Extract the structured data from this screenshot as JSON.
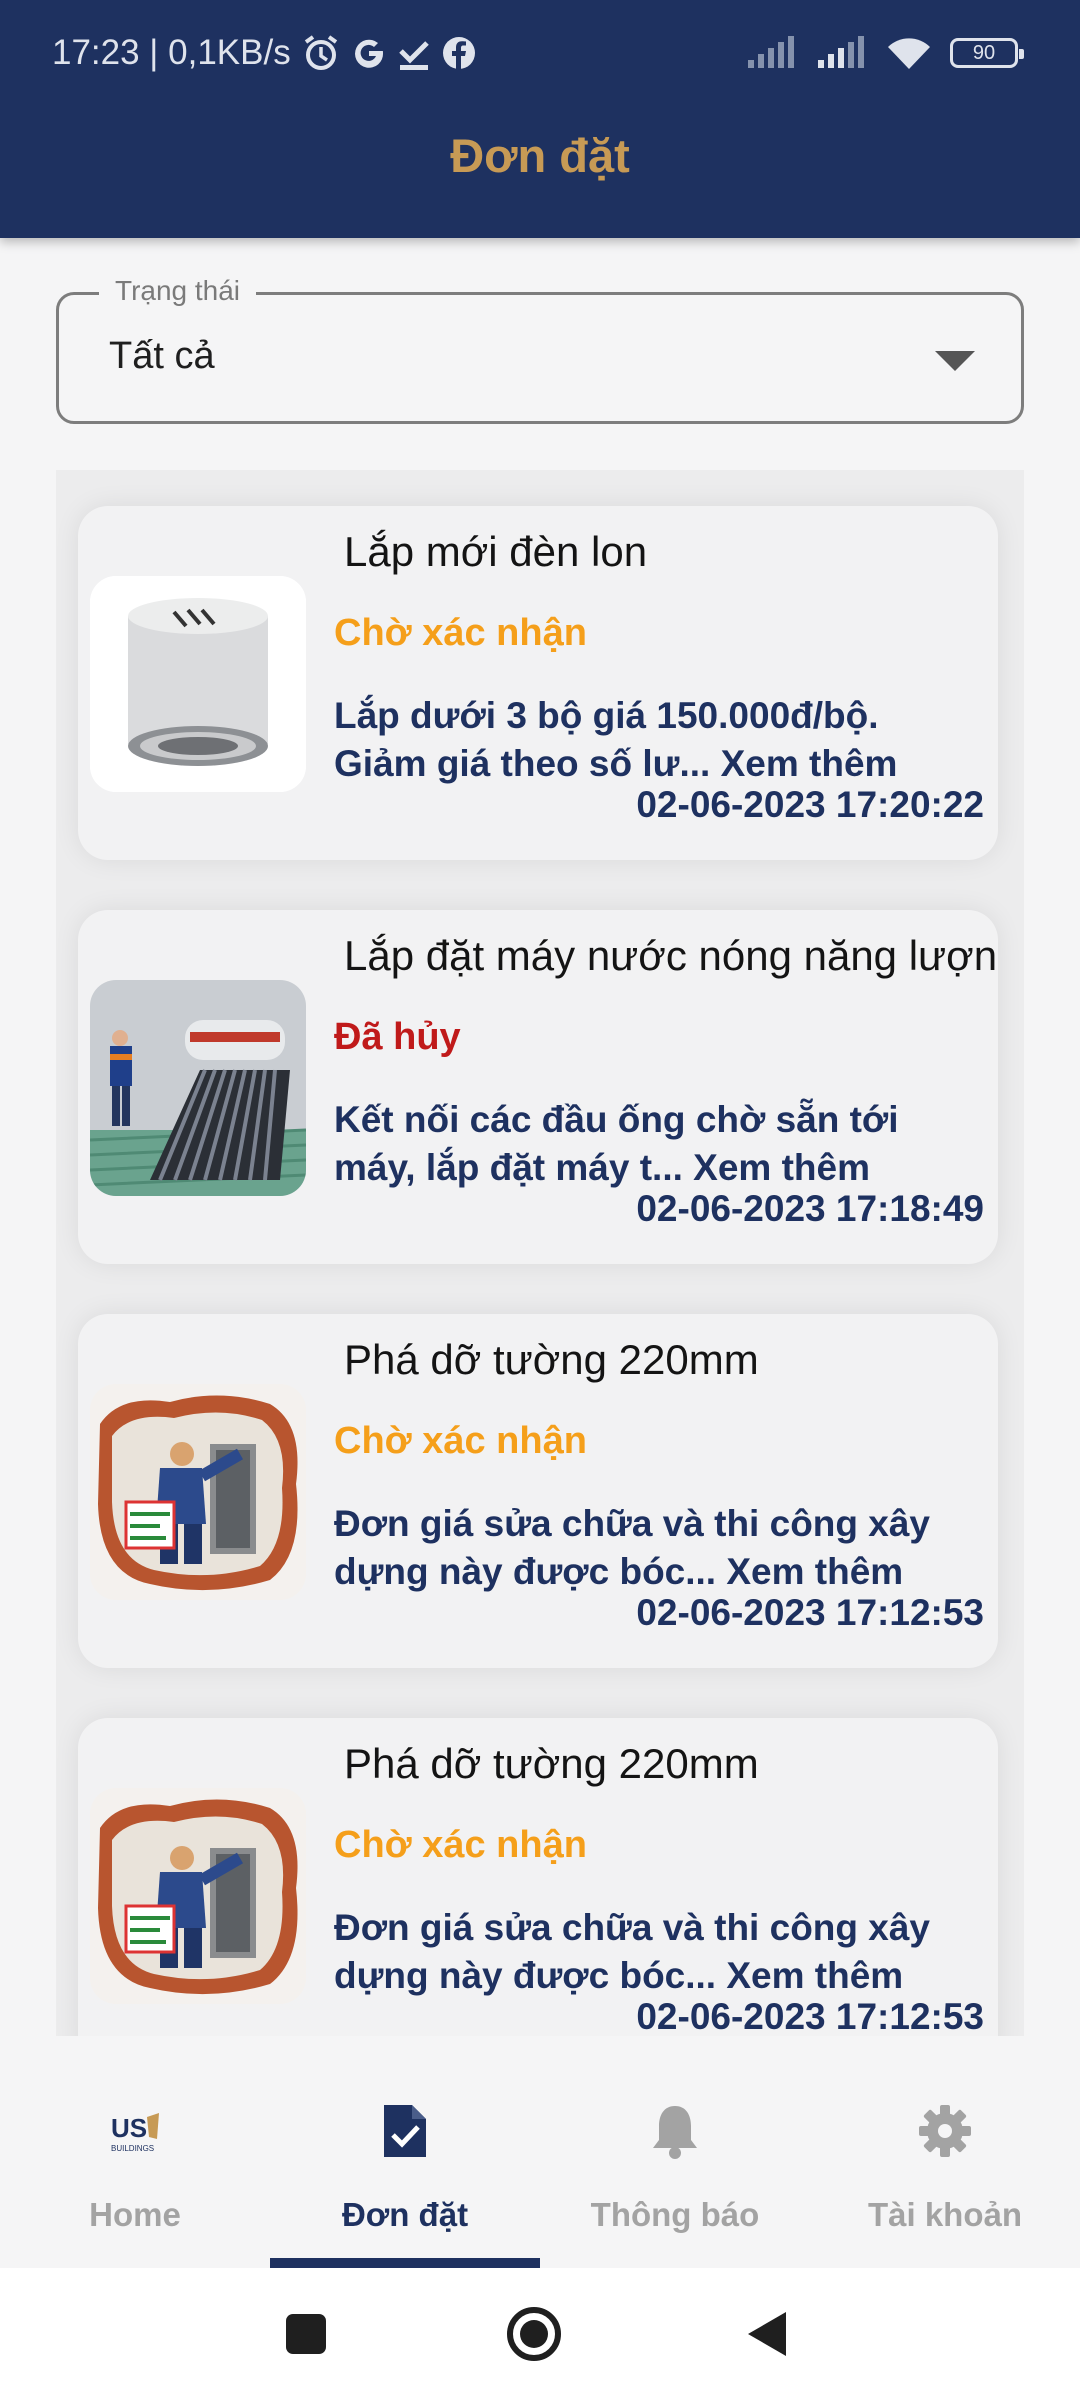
{
  "status_bar": {
    "time_and_speed": "17:23 | 0,1KB/s",
    "battery": "90"
  },
  "header": {
    "title": "Đơn đặt"
  },
  "filter": {
    "label": "Trạng thái",
    "value": "Tất cả"
  },
  "orders": [
    {
      "title": "Lắp mới đèn lon",
      "status": "Chờ xác nhận",
      "description": "Lắp dưới 3 bộ giá 150.000đ/bộ. Giảm giá theo số lư... Xem thêm",
      "datetime": "02-06-2023 17:20:22"
    },
    {
      "title": "Lắp đặt máy nước nóng năng lượng",
      "status": "Đã hủy",
      "description": "Kết nối các đầu ống chờ sẵn tới máy, lắp đặt máy t... Xem thêm",
      "datetime": "02-06-2023 17:18:49"
    },
    {
      "title": "Phá dỡ tường 220mm",
      "status": "Chờ xác nhận",
      "description": "Đơn giá sửa chữa và thi công xây dựng này được bóc... Xem thêm",
      "datetime": "02-06-2023 17:12:53"
    },
    {
      "title": "Phá dỡ tường 220mm",
      "status": "Chờ xác nhận",
      "description": "Đơn giá sửa chữa và thi công xây dựng này được bóc... Xem thêm",
      "datetime": "02-06-2023 17:12:53"
    }
  ],
  "bottom_nav": {
    "home": "Home",
    "orders": "Đơn đặt",
    "notifications": "Thông báo",
    "account": "Tài khoản"
  },
  "colors": {
    "brand": "#1e3160",
    "title_gold": "#c79a55",
    "pending": "#f59f1a",
    "cancelled": "#c01a1a"
  }
}
